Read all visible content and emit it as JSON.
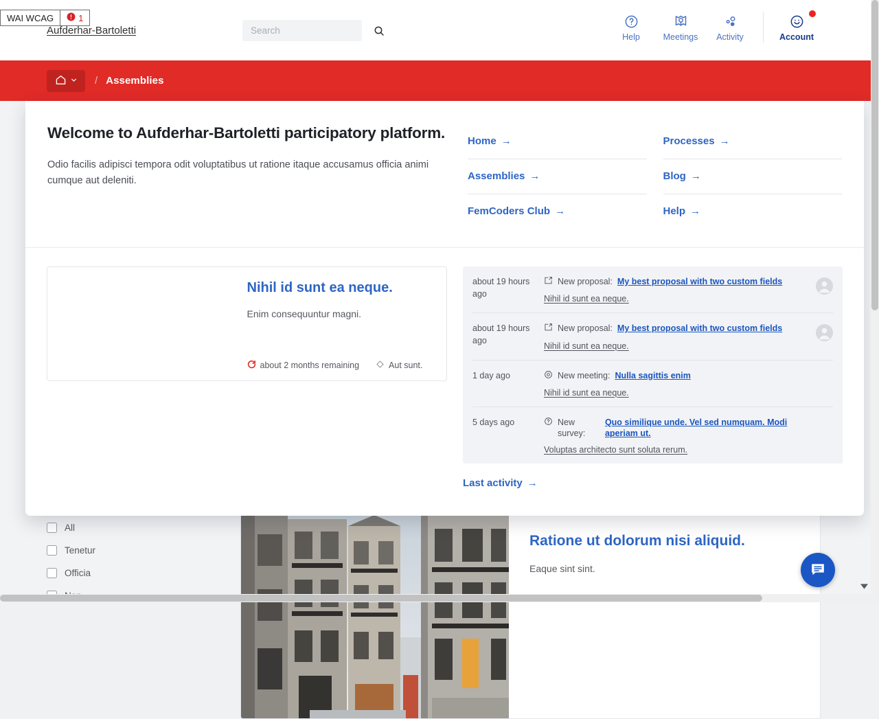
{
  "accessibility_badge": {
    "label": "WAI WCAG",
    "count": "1",
    "icon": "alert-circle-icon"
  },
  "header": {
    "brand": "Aufderhar-Bartoletti",
    "search": {
      "value": "",
      "placeholder": "Search",
      "icon": "search-icon"
    },
    "nav": [
      {
        "label": "Help",
        "icon": "question-circle-icon",
        "notification": false
      },
      {
        "label": "Meetings",
        "icon": "map-pin-icon",
        "notification": false
      },
      {
        "label": "Activity",
        "icon": "activity-dots-icon",
        "notification": false
      },
      {
        "label": "Account",
        "icon": "smiley-face-icon",
        "notification": true
      }
    ]
  },
  "breadcrumb": {
    "home_icon": "home-icon",
    "chevron_icon": "chevron-down-icon",
    "separator": "/",
    "current": "Assemblies",
    "bar_color": "#e02b27"
  },
  "welcome": {
    "title": "Welcome to Aufderhar-Bartoletti participatory platform.",
    "description": "Odio facilis adipisci tempora odit voluptatibus ut ratione itaque accusamus officia animi cumque aut deleniti.",
    "quick_links": [
      {
        "label": "Home",
        "arrow": "→"
      },
      {
        "label": "Processes",
        "arrow": "→"
      },
      {
        "label": "Assemblies",
        "arrow": "→"
      },
      {
        "label": "Blog",
        "arrow": "→"
      },
      {
        "label": "FemCoders Club",
        "arrow": "→"
      },
      {
        "label": "Help",
        "arrow": "→"
      }
    ]
  },
  "highlight_card": {
    "title": "Nihil id sunt ea neque.",
    "subtitle": "Enim consequuntur magni.",
    "meta": [
      {
        "icon": "progress-circle-icon",
        "text": "about 2 months remaining",
        "color": "#e02b27"
      },
      {
        "icon": "diamond-icon",
        "text": "Aut sunt.",
        "color": "#8a8f98"
      }
    ]
  },
  "activity_feed": {
    "items": [
      {
        "time": "about 19 hours ago",
        "icon": "proposal-icon",
        "kind": "New proposal:",
        "title": "My best proposal with two custom fields",
        "context": "Nihil id sunt ea neque.",
        "avatar": "user-avatar"
      },
      {
        "time": "about 19 hours ago",
        "icon": "proposal-icon",
        "kind": "New proposal:",
        "title": "My best proposal with two custom fields",
        "context": "Nihil id sunt ea neque.",
        "avatar": "user-avatar"
      },
      {
        "time": "1 day ago",
        "icon": "meeting-pin-icon",
        "kind": "New meeting:",
        "title": "Nulla sagittis enim",
        "context": "Nihil id sunt ea neque.",
        "avatar": ""
      },
      {
        "time": "5 days ago",
        "icon": "survey-question-icon",
        "kind": "New survey:",
        "title": "Quo similique unde. Vel sed numquam. Modi aperiam ut.",
        "context": "Voluptas architecto sunt soluta rerum.",
        "avatar": ""
      }
    ],
    "footer_link": {
      "label": "Last activity",
      "arrow": "→"
    }
  },
  "background": {
    "filters": [
      {
        "label": "All",
        "checked": false
      },
      {
        "label": "Tenetur",
        "checked": false
      },
      {
        "label": "Officia",
        "checked": false
      },
      {
        "label": "Non",
        "checked": false
      }
    ],
    "card": {
      "title": "Ratione ut dolorum nisi aliquid.",
      "subtitle": "Eaque sint sint.",
      "image_alt": "street-photo"
    },
    "chat_button": {
      "icon": "chat-bubble-icon",
      "color": "#1a57c4"
    }
  }
}
